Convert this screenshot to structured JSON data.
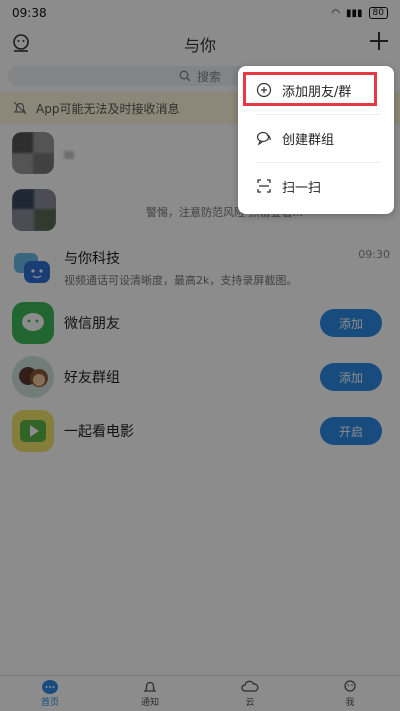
{
  "status_bar": {
    "time": "09:38",
    "battery": "80"
  },
  "header": {
    "title": "与你"
  },
  "search": {
    "placeholder": "搜索"
  },
  "notice": {
    "text": "App可能无法及时接收消息"
  },
  "chats": [
    {
      "name": "",
      "subtitle": "",
      "time": ""
    },
    {
      "name": "",
      "subtitle": "警惕，注意防范风险 点击查看...",
      "time": ""
    },
    {
      "name": "与你科技",
      "subtitle": "视频通话可设清晰度，最高2k，支持录屏截图。",
      "time": "09:30"
    }
  ],
  "features": [
    {
      "name": "微信朋友",
      "action": "添加",
      "color": "#3cba5a"
    },
    {
      "name": "好友群组",
      "action": "添加",
      "color": "#4a9a8a"
    },
    {
      "name": "一起看电影",
      "action": "开启",
      "color": "#6cc04a"
    }
  ],
  "menu": {
    "items": [
      {
        "label": "添加朋友/群",
        "icon": "add-circle-icon"
      },
      {
        "label": "创建群组",
        "icon": "group-chat-icon"
      },
      {
        "label": "扫一扫",
        "icon": "scan-icon"
      }
    ]
  },
  "bottom_nav": [
    {
      "label": "首页",
      "icon": "home-chat-icon",
      "active": true
    },
    {
      "label": "通知",
      "icon": "bell-icon",
      "active": false
    },
    {
      "label": "云",
      "icon": "cloud-icon",
      "active": false
    },
    {
      "label": "我",
      "icon": "profile-icon",
      "active": false
    }
  ],
  "colors": {
    "accent": "#2f8be6",
    "highlight": "#e53946"
  }
}
